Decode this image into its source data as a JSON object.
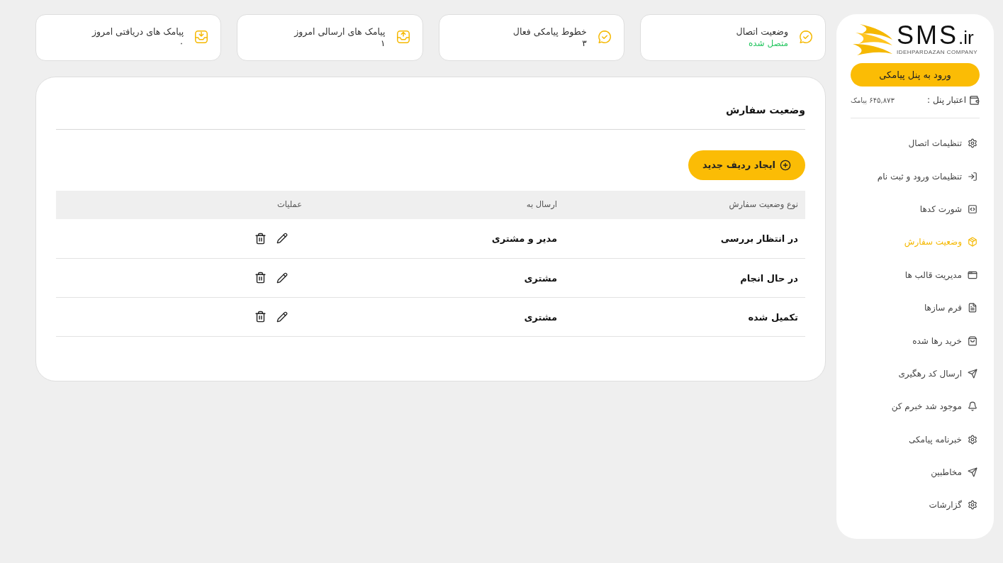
{
  "sidebar": {
    "logo": {
      "main": "SMS",
      "suffix": ".ir",
      "tagline": "IDEHPARDAZAN COMPANY"
    },
    "login_button": "ورود به پنل پیامکی",
    "credit": {
      "label": "اعتبار پنل :",
      "value": "۶۴۵,۸۷۳ پیامک"
    },
    "items": [
      {
        "label": "تنظیمات اتصال",
        "selected": false
      },
      {
        "label": "تنظیمات ورود و ثبت نام",
        "selected": false
      },
      {
        "label": "شورت کدها",
        "selected": false
      },
      {
        "label": "وضعیت سفارش",
        "selected": true
      },
      {
        "label": "مدیریت قالب ها",
        "selected": false
      },
      {
        "label": "فرم سازها",
        "selected": false
      },
      {
        "label": "خرید رها شده",
        "selected": false
      },
      {
        "label": "ارسال کد رهگیری",
        "selected": false
      },
      {
        "label": "موجود شد خبرم کن",
        "selected": false
      },
      {
        "label": "خبرنامه پیامکی",
        "selected": false
      },
      {
        "label": "مخاطبین",
        "selected": false
      },
      {
        "label": "گزارشات",
        "selected": false
      }
    ]
  },
  "stats": [
    {
      "label": "وضعیت اتصال",
      "value": "متصل شده",
      "kind": "status"
    },
    {
      "label": "خطوط پیامکی فعال",
      "value": "۳",
      "kind": "count"
    },
    {
      "label": "پیامک های ارسالی امروز",
      "value": "۱",
      "kind": "count"
    },
    {
      "label": "پیامک های دریافتی امروز",
      "value": "۰",
      "kind": "count"
    }
  ],
  "panel": {
    "title": "وضعیت سفارش",
    "add_button": "ایجاد ردیف جدید",
    "table": {
      "columns": [
        "نوع وضعیت سفارش",
        "ارسال به",
        "عملیات"
      ],
      "rows": [
        {
          "status": "در انتظار بررسی",
          "send_to": "مدیر و مشتری"
        },
        {
          "status": "در حال انجام",
          "send_to": "مشتری"
        },
        {
          "status": "تکمیل شده",
          "send_to": "مشتری"
        }
      ]
    }
  }
}
